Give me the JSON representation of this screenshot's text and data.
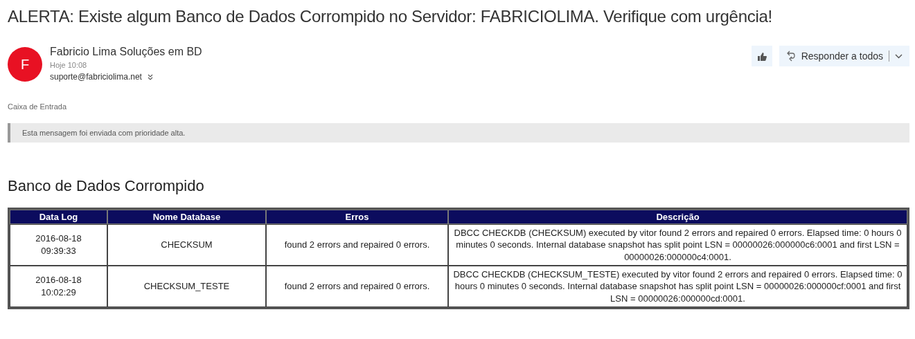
{
  "subject": "ALERTA: Existe algum Banco de Dados Corrompido no Servidor: FABRICIOLIMA. Verifique com urgência!",
  "sender": {
    "initial": "F",
    "name": "Fabricio Lima Soluções em BD",
    "time": "Hoje 10:08",
    "email": "suporte@fabriciolima.net"
  },
  "actions": {
    "reply_all": "Responder a todos"
  },
  "folder": "Caixa de Entrada",
  "priority_notice": "Esta mensagem foi enviada com prioridade alta.",
  "body": {
    "heading": "Banco de Dados Corrompido",
    "table": {
      "columns": [
        "Data Log",
        "Nome Database",
        "Erros",
        "Descrição"
      ],
      "rows": [
        [
          "2016-08-18 09:39:33",
          "CHECKSUM",
          "found 2 errors and repaired 0 errors.",
          "DBCC CHECKDB (CHECKSUM) executed by vitor found 2 errors and repaired 0 errors. Elapsed time: 0 hours 0 minutes 0 seconds. Internal database snapshot has split point LSN = 00000026:000000c6:0001 and first LSN = 00000026:000000c4:0001."
        ],
        [
          "2016-08-18 10:02:29",
          "CHECKSUM_TESTE",
          "found 2 errors and repaired 0 errors.",
          "DBCC CHECKDB (CHECKSUM_TESTE) executed by vitor found 2 errors and repaired 0 errors. Elapsed time: 0 hours 0 minutes 0 seconds. Internal database snapshot has split point LSN = 00000026:000000cf:0001 and first LSN = 00000026:000000cd:0001."
        ]
      ]
    }
  }
}
